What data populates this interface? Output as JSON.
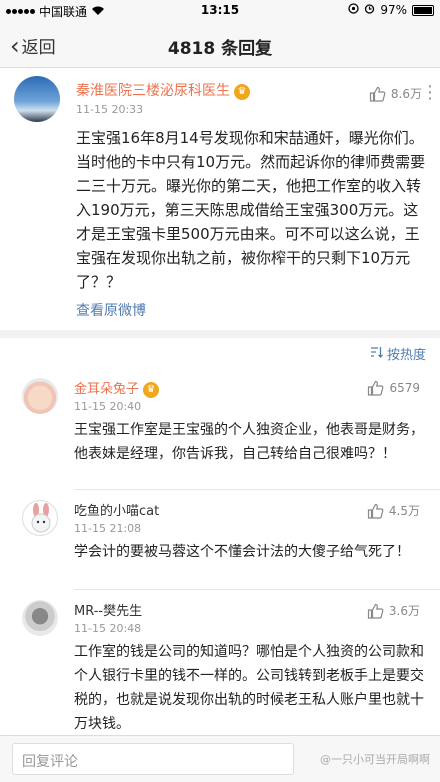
{
  "status": {
    "carrier": "中国联通",
    "time": "13:15",
    "battery": "97%"
  },
  "nav": {
    "back_label": "返回",
    "title": "4818 条回复"
  },
  "post": {
    "author": "秦淮医院三楼泌尿科医生",
    "time": "11-15 20:33",
    "likes": "8.6万",
    "text": "王宝强16年8月14号发现你和宋喆通奸，曝光你们。当时他的卡中只有10万元。然而起诉你的律师费需要二三十万元。曝光你的第二天，他把工作室的收入转入190万元，第三天陈思成借给王宝强300万元。这才是王宝强卡里500万元由来。可不可以这么说，王宝强在发现你出轨之前，被你榨干的只剩下10万元了？？",
    "view_original": "查看原微博"
  },
  "sort_label": "按热度",
  "comments": [
    {
      "author": "金耳朵兔子",
      "time": "11-15 20:40",
      "likes": "6579",
      "text": "王宝强工作室是王宝强的个人独资企业，他表哥是财务，他表妹是经理，你告诉我，自己转给自己很难吗？！"
    },
    {
      "author": "吃鱼的小喵cat",
      "time": "11-15 21:08",
      "likes": "4.5万",
      "text": "学会计的要被马蓉这个不懂会计法的大傻子给气死了！"
    },
    {
      "author": "MR--樊先生",
      "time": "11-15 20:48",
      "likes": "3.6万",
      "text": "工作室的钱是公司的知道吗？哪怕是个人独资的公司款和个人银行卡里的钱不一样的。公司钱转到老板手上是要交税的，也就是说发现你出轨的时候老王私人账户里也就十万块钱。"
    }
  ],
  "footer": {
    "reply_placeholder": "回复评论",
    "watermark": "@一只小可当开局啊啊"
  },
  "colors": {
    "author": "#eb7350",
    "link": "#507daf",
    "vip_badge": "#f0a61d"
  }
}
